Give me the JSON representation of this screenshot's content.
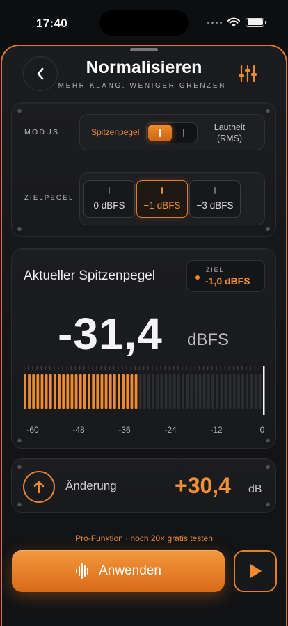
{
  "status": {
    "time": "17:40"
  },
  "header": {
    "title": "Normalisieren",
    "subtitle": "MEHR KLANG. WENIGER GRENZEN.",
    "back_icon": "chevron-left-icon",
    "settings_icon": "sliders-icon"
  },
  "mode": {
    "label": "MODUS",
    "option_left": "Spitzenpegel",
    "option_right": "Lautheit (RMS)",
    "selected": "Spitzenpegel"
  },
  "target": {
    "label": "ZIELPEGEL",
    "options": [
      "0 dBFS",
      "−1 dBFS",
      "−3 dBFS"
    ],
    "selected": "−1 dBFS"
  },
  "peak": {
    "title": "Aktueller Spitzenpegel",
    "ziel_label": "ZIEL",
    "ziel_value": "-1,0 dBFS",
    "value": "-31,4",
    "unit": "dBFS",
    "meter_level_db": -31.4,
    "meter_min_db": -60,
    "meter_max_db": 0,
    "scale": [
      "-60",
      "-48",
      "-36",
      "-24",
      "-12",
      "0"
    ]
  },
  "change": {
    "label": "Änderung",
    "value": "+30,4",
    "unit": "dB",
    "icon": "arrow-up-icon"
  },
  "promo": "Pro-Funktion · noch 20× gratis testen",
  "actions": {
    "apply_label": "Anwenden",
    "apply_icon": "waveform-icon",
    "play_icon": "play-icon"
  },
  "colors": {
    "accent": "#ee8a2f",
    "background": "#141517"
  }
}
